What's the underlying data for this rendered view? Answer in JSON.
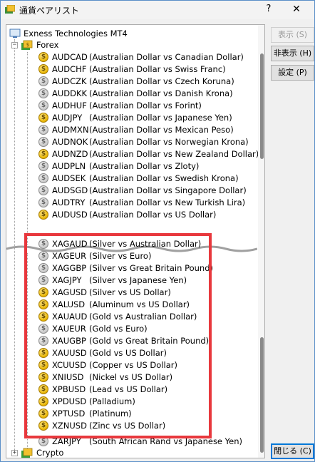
{
  "window": {
    "title": "通貨ペアリスト",
    "help_label": "?",
    "close_label": "✕"
  },
  "tree": {
    "root_label": "Exness Technologies MT4",
    "forex_label": "Forex",
    "crypto_label": "Crypto",
    "forex_symbols": [
      {
        "name": "AUDCAD",
        "desc": "(Australian Dollar vs Canadian Dollar)",
        "active": true
      },
      {
        "name": "AUDCHF",
        "desc": "(Australian Dollar vs Swiss Franc)",
        "active": true
      },
      {
        "name": "AUDCZK",
        "desc": "(Australian Dollar vs Czech Koruna)",
        "active": false
      },
      {
        "name": "AUDDKK",
        "desc": "(Australian Dollar vs Danish Krona)",
        "active": false
      },
      {
        "name": "AUDHUF",
        "desc": "(Australian Dollar vs Forint)",
        "active": false
      },
      {
        "name": "AUDJPY",
        "desc": "(Australian Dollar vs Japanese Yen)",
        "active": true
      },
      {
        "name": "AUDMXN",
        "desc": "(Australian Dollar vs Mexican Peso)",
        "active": false
      },
      {
        "name": "AUDNOK",
        "desc": "(Australian Dollar vs Norwegian Krona)",
        "active": false
      },
      {
        "name": "AUDNZD",
        "desc": "(Australian Dollar vs New Zealand Dollar)",
        "active": true
      },
      {
        "name": "AUDPLN",
        "desc": "(Australian Dollar vs Zloty)",
        "active": false
      },
      {
        "name": "AUDSEK",
        "desc": "(Australian Dollar vs Swedish Krona)",
        "active": false
      },
      {
        "name": "AUDSGD",
        "desc": "(Australian Dollar vs Singapore Dollar)",
        "active": false
      },
      {
        "name": "AUDTRY",
        "desc": "(Australian Dollar vs New Turkish Lira)",
        "active": false
      },
      {
        "name": "AUDUSD",
        "desc": "(Australian Dollar vs US Dollar)",
        "active": true
      }
    ],
    "metal_symbols": [
      {
        "name": "XAGAUD",
        "desc": "(Silver vs Australian Dollar)",
        "active": false
      },
      {
        "name": "XAGEUR",
        "desc": "(Silver vs Euro)",
        "active": false
      },
      {
        "name": "XAGGBP",
        "desc": "(Silver vs Great Britain Pound)",
        "active": false
      },
      {
        "name": "XAGJPY",
        "desc": "(Silver vs Japanese Yen)",
        "active": false
      },
      {
        "name": "XAGUSD",
        "desc": "(Silver vs US Dollar)",
        "active": true
      },
      {
        "name": "XALUSD",
        "desc": "(Aluminum vs US Dollar)",
        "active": true
      },
      {
        "name": "XAUAUD",
        "desc": "(Gold vs Australian Dollar)",
        "active": true
      },
      {
        "name": "XAUEUR",
        "desc": "(Gold vs Euro)",
        "active": false
      },
      {
        "name": "XAUGBP",
        "desc": "(Gold vs Great Britain Pound)",
        "active": false
      },
      {
        "name": "XAUUSD",
        "desc": "(Gold vs US Dollar)",
        "active": true
      },
      {
        "name": "XCUUSD",
        "desc": "(Copper vs US Dollar)",
        "active": true
      },
      {
        "name": "XNIUSD",
        "desc": "(Nickel vs US Dollar)",
        "active": true
      },
      {
        "name": "XPBUSD",
        "desc": "(Lead vs US Dollar)",
        "active": true
      },
      {
        "name": "XPDUSD",
        "desc": "(Palladium)",
        "active": true
      },
      {
        "name": "XPTUSD",
        "desc": "(Platinum)",
        "active": true
      },
      {
        "name": "XZNUSD",
        "desc": "(Zinc vs US Dollar)",
        "active": true
      }
    ],
    "partial_symbol": {
      "name": "ZARJPY",
      "desc": "(South African Rand vs Japanese Yen)",
      "active": false
    }
  },
  "buttons": {
    "show": "表示 (S)",
    "hide": "非表示 (H)",
    "properties": "設定 (P)",
    "close": "閉じる (C)"
  },
  "colors": {
    "active_icon": "#e8b400",
    "inactive_icon": "#c8c8c8",
    "highlight_border": "#e8383d"
  },
  "icons": {
    "symbol_icon": "dollar-coin-icon",
    "group_icon": "folder-icon"
  }
}
